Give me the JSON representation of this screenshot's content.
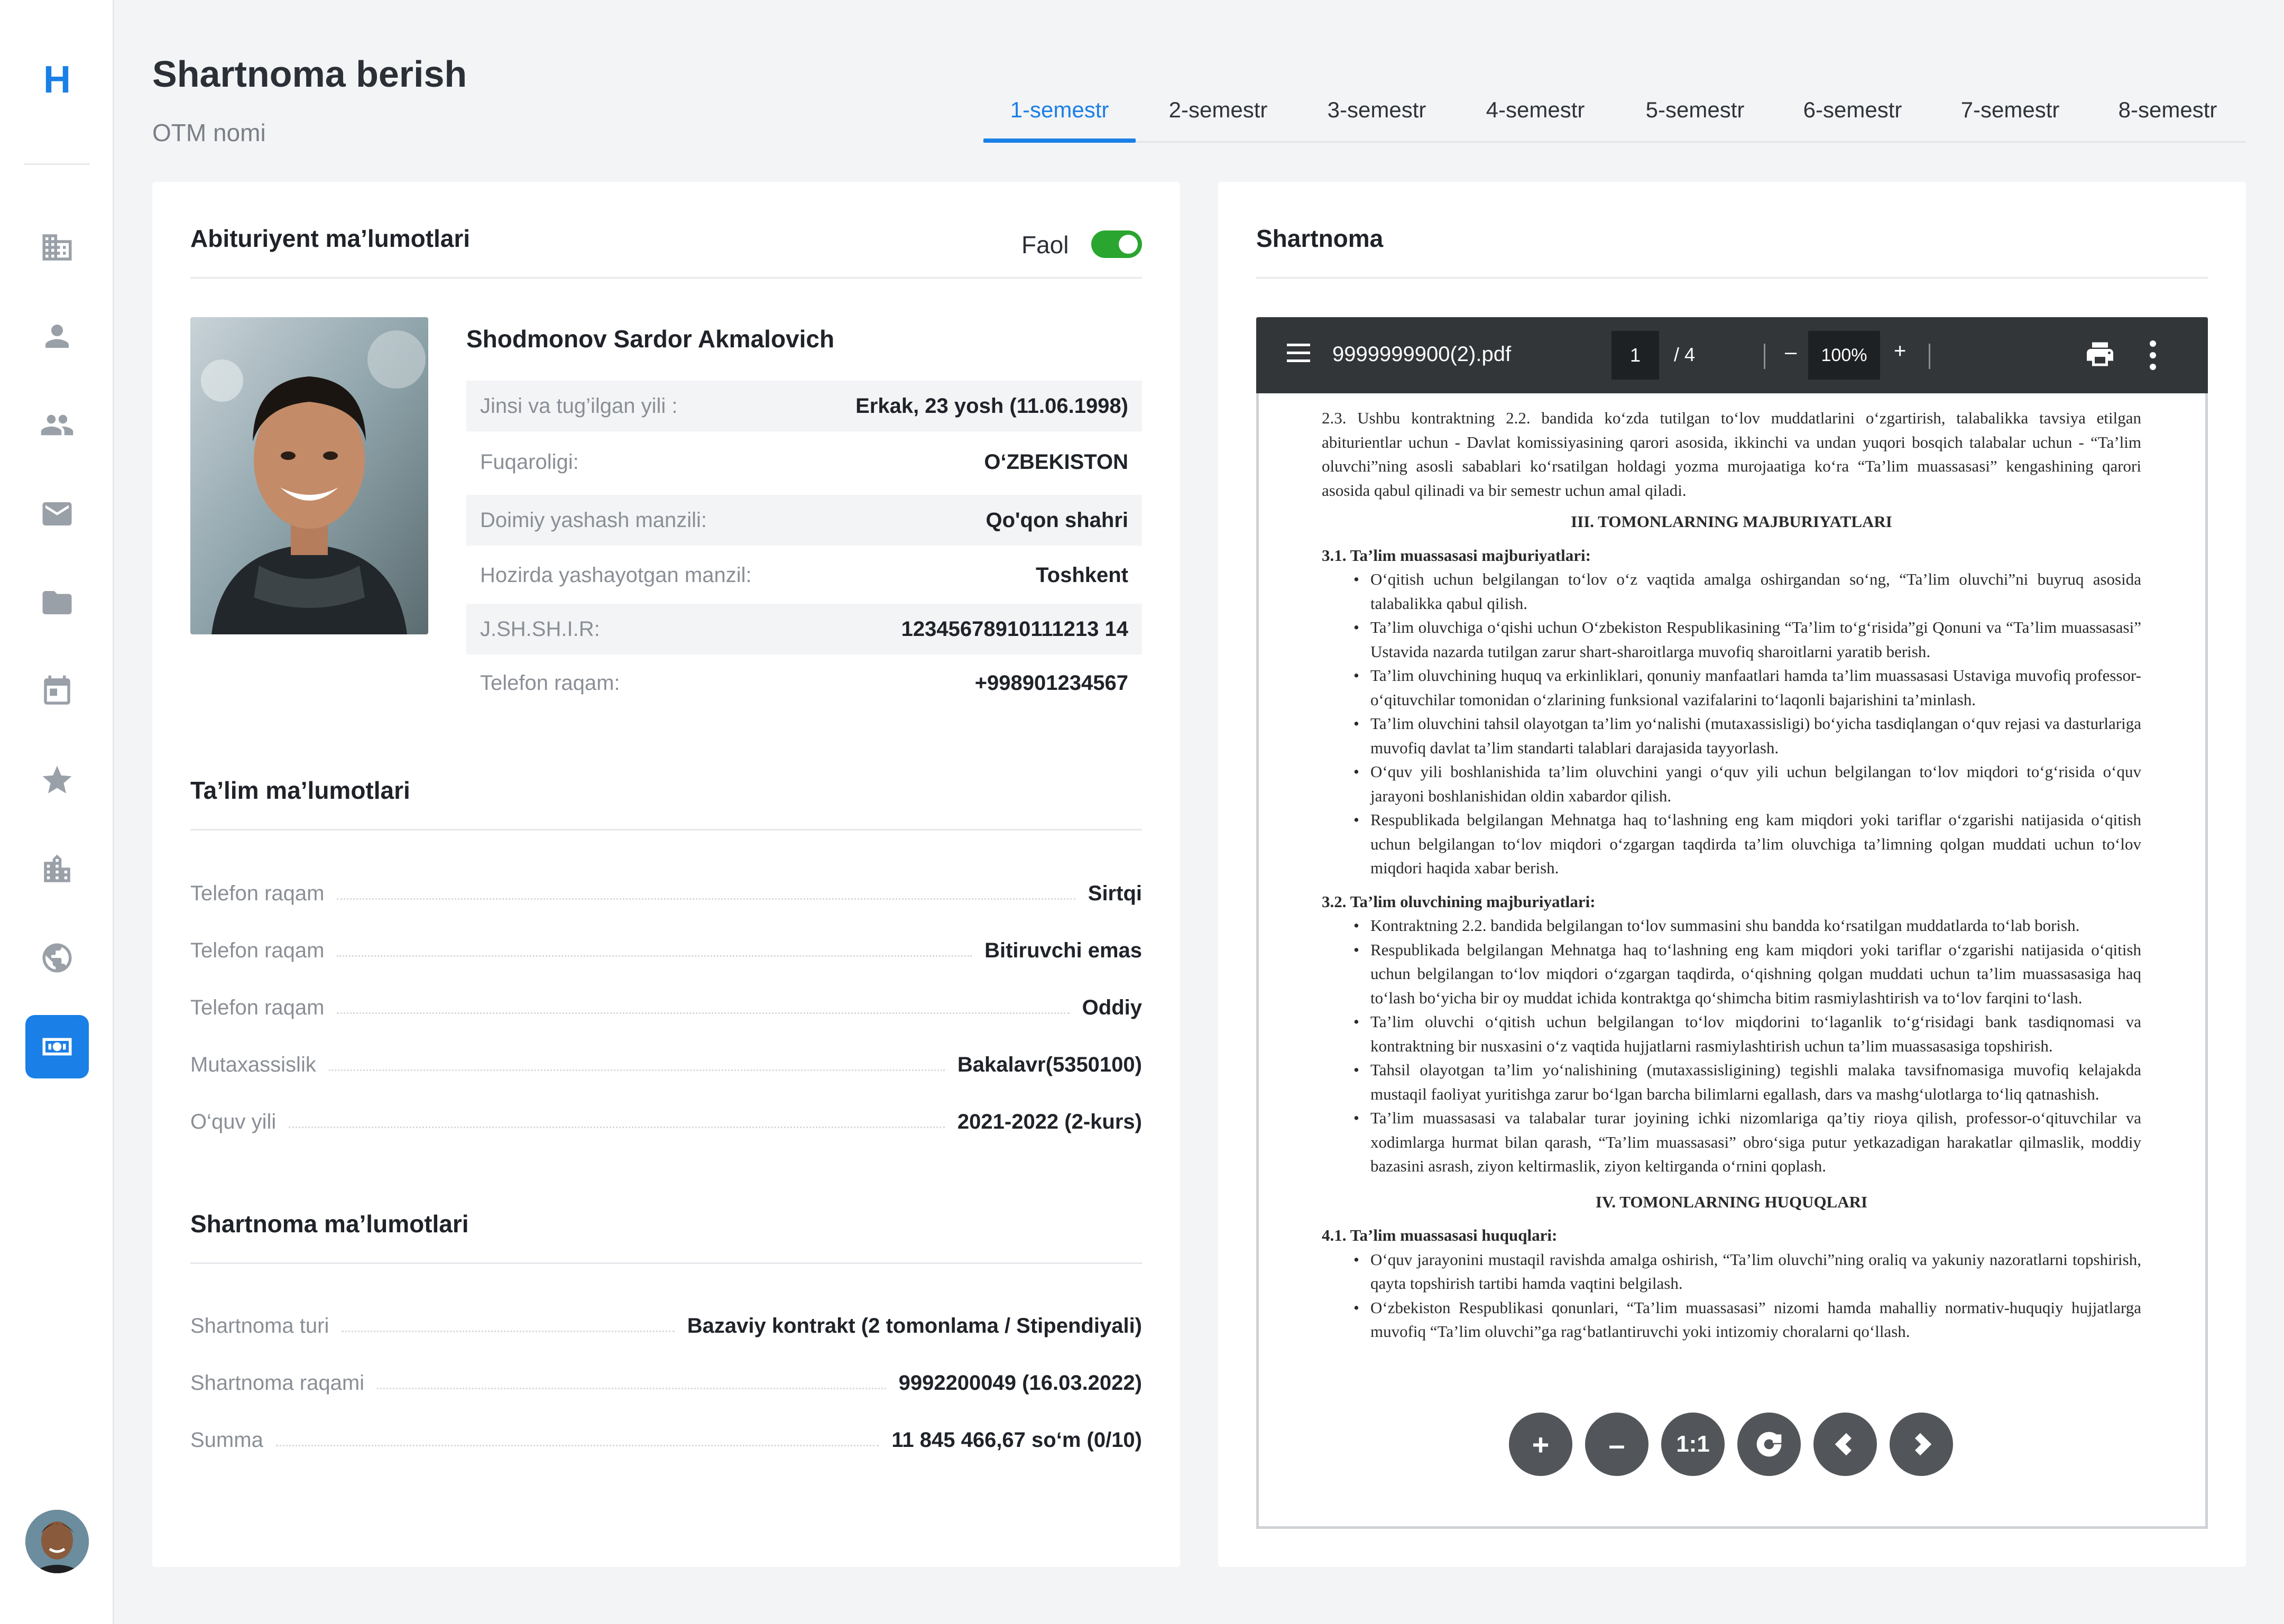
{
  "sidebar": {
    "logo": "H",
    "items": [
      {
        "icon": "building-icon"
      },
      {
        "icon": "person-icon"
      },
      {
        "icon": "people-icon"
      },
      {
        "icon": "mail-icon"
      },
      {
        "icon": "folder-icon"
      },
      {
        "icon": "calendar-icon"
      },
      {
        "icon": "star-icon"
      },
      {
        "icon": "office-building-icon"
      },
      {
        "icon": "globe-icon"
      },
      {
        "icon": "payments-icon",
        "active": true
      }
    ]
  },
  "header": {
    "title": "Shartnoma berish",
    "subtitle": "OTM nomi"
  },
  "tabs": [
    {
      "label": "1-semestr",
      "active": true
    },
    {
      "label": "2-semestr"
    },
    {
      "label": "3-semestr"
    },
    {
      "label": "4-semestr"
    },
    {
      "label": "5-semestr"
    },
    {
      "label": "6-semestr"
    },
    {
      "label": "7-semestr"
    },
    {
      "label": "8-semestr"
    }
  ],
  "applicant": {
    "title": "Abituriyent ma’lumotlari",
    "status_label": "Faol",
    "status_on": true,
    "name": "Shodmonov Sardor Akmalovich",
    "fields": [
      {
        "label": "Jinsi va tug’ilgan yili :",
        "value": "Erkak, 23 yosh (11.06.1998)"
      },
      {
        "label": "Fuqaroligi:",
        "value": "O‘ZBEKISTON"
      },
      {
        "label": "Doimiy yashash manzili:",
        "value": "Qo'qon shahri"
      },
      {
        "label": "Hozirda yashayotgan manzil:",
        "value": "Toshkent"
      },
      {
        "label": "J.SH.SH.I.R:",
        "value": "12345678910111213 14"
      },
      {
        "label": "Telefon raqam:",
        "value": "+998901234567"
      }
    ]
  },
  "education": {
    "title": "Ta’lim ma’lumotlari",
    "rows": [
      {
        "label": "Telefon raqam",
        "value": "Sirtqi"
      },
      {
        "label": "Telefon raqam",
        "value": "Bitiruvchi emas"
      },
      {
        "label": "Telefon raqam",
        "value": "Oddiy"
      },
      {
        "label": "Mutaxassislik",
        "value": "Bakalavr(5350100)"
      },
      {
        "label": "O‘quv yili",
        "value": "2021-2022 (2-kurs)"
      }
    ]
  },
  "contract": {
    "title": "Shartnoma ma’lumotlari",
    "rows": [
      {
        "label": "Shartnoma turi",
        "value": "Bazaviy kontrakt (2 tomonlama / Stipendiyali)"
      },
      {
        "label": "Shartnoma raqami",
        "value": "9992200049 (16.03.2022)"
      },
      {
        "label": "Summa",
        "value": "11 845 466,67 so‘m (0/10)"
      }
    ]
  },
  "document": {
    "title": "Shartnoma",
    "filename": "9999999900(2).pdf",
    "page_current": "1",
    "page_total": "/ 4",
    "zoom": "100%",
    "zoom_minus": "–",
    "zoom_plus": "+",
    "paragraph_2_3": "2.3. Ushbu kontraktning 2.2. bandida ko‘zda tutilgan to‘lov muddatlarini o‘zgartirish, talabalikka tavsiya etilgan abiturientlar uchun - Davlat komissiyasining qarori asosida, ikkinchi va undan yuqori bosqich talabalar uchun - “Ta’lim oluvchi”ning asosli sabablari ko‘rsatilgan holdagi yozma murojaatiga ko‘ra “Ta’lim muassasasi” kengashining qarori asosida qabul qilinadi va bir semestr uchun amal qiladi.",
    "heading_3": "III. TOMONLARNING MAJBURIYATLARI",
    "sub_3_1": "3.1. Ta’lim muassasasi majburiyatlari:",
    "items_3_1": [
      "O‘qitish uchun belgilangan to‘lov o‘z vaqtida amalga oshirgandan so‘ng, “Ta’lim oluvchi”ni buyruq asosida talabalikka qabul qilish.",
      "Ta’lim oluvchiga o‘qishi uchun O‘zbekiston Respublikasining “Ta’lim to‘g‘risida”gi Qonuni va “Ta’lim muassasasi” Ustavida nazarda tutilgan zarur shart-sharoitlarga muvofiq sharoitlarni yaratib berish.",
      "Ta’lim oluvchining huquq va erkinliklari, qonuniy manfaatlari hamda ta’lim muassasasi Ustaviga muvofiq professor-o‘qituvchilar tomonidan o‘zlarining funksional vazifalarini to‘laqonli bajarishini ta’minlash.",
      "Ta’lim oluvchini tahsil olayotgan ta’lim yo‘nalishi (mutaxassisligi) bo‘yicha tasdiqlangan o‘quv rejasi va dasturlariga muvofiq davlat ta’lim standarti talablari darajasida tayyorlash.",
      "O‘quv yili boshlanishida ta’lim oluvchini yangi o‘quv yili uchun belgilangan to‘lov miqdori to‘g‘risida o‘quv jarayoni boshlanishidan oldin xabardor qilish.",
      "Respublikada belgilangan Mehnatga haq to‘lashning eng kam miqdori yoki tariflar o‘zgarishi natijasida o‘qitish uchun belgilangan to‘lov miqdori o‘zgargan taqdirda ta’lim oluvchiga ta’limning qolgan muddati uchun to‘lov miqdori haqida xabar berish."
    ],
    "sub_3_2": "3.2. Ta’lim oluvchining majburiyatlari:",
    "items_3_2": [
      "Kontraktning 2.2. bandida belgilangan to‘lov summasini shu bandda ko‘rsatilgan muddatlarda to‘lab borish.",
      "Respublikada belgilangan Mehnatga haq to‘lashning eng kam miqdori yoki tariflar o‘zgarishi natijasida o‘qitish uchun belgilangan to‘lov miqdori o‘zgargan taqdirda, o‘qishning qolgan muddati uchun ta’lim muassasasiga haq to‘lash bo‘yicha bir oy muddat ichida kontraktga qo‘shimcha bitim rasmiylashtirish va to‘lov farqini to‘lash.",
      "Ta’lim oluvchi o‘qitish uchun belgilangan to‘lov miqdorini to‘laganlik to‘g‘risidagi bank tasdiqnomasi va kontraktning bir nusxasini o‘z vaqtida hujjatlarni rasmiylashtirish uchun ta’lim muassasasiga topshirish.",
      "Tahsil olayotgan ta’lim yo‘nalishining (mutaxassisligining) tegishli malaka tavsifnomasiga muvofiq kelajakda mustaqil faoliyat yuritishga zarur bo‘lgan barcha bilimlarni egallash, dars va mashg‘ulotlarga to‘liq qatnashish.",
      "Ta’lim muassasasi va talabalar turar joyining ichki nizomlariga qa’tiy rioya qilish, professor-o‘qituvchilar va xodimlarga hurmat bilan qarash, “Ta’lim muassasasi” obro‘siga putur yetkazadigan harakatlar qilmaslik, moddiy bazasini asrash, ziyon keltirmaslik, ziyon keltirganda o‘rnini qoplash."
    ],
    "heading_4": "IV. TOMONLARNING HUQUQLARI",
    "sub_4_1": "4.1. Ta’lim muassasasi huquqlari:",
    "items_4_1": [
      "O‘quv jarayonini mustaqil ravishda amalga oshirish, “Ta’lim oluvchi”ning oraliq va yakuniy nazoratlarni topshirish, qayta topshirish tartibi hamda vaqtini belgilash.",
      "O‘zbekiston Respublikasi qonunlari, “Ta’lim muassasasi” nizomi hamda mahalliy normativ-huquqiy hujjatlarga muvofiq “Ta’lim oluvchi”ga rag‘batlantiruvchi yoki intizomiy choralarni qo‘llash."
    ],
    "controls": [
      {
        "icon": "zoom-in-icon",
        "label": "+"
      },
      {
        "icon": "zoom-out-icon",
        "label": "–"
      },
      {
        "icon": "actual-size-icon",
        "label": "1:1"
      },
      {
        "icon": "rotate-icon",
        "label": ""
      },
      {
        "icon": "previous-page-icon",
        "label": ""
      },
      {
        "icon": "next-page-icon",
        "label": ""
      }
    ]
  },
  "colors": {
    "accent": "#1a7fe6",
    "toggle_on": "#2aa52f",
    "pdf_toolbar": "#323639"
  }
}
